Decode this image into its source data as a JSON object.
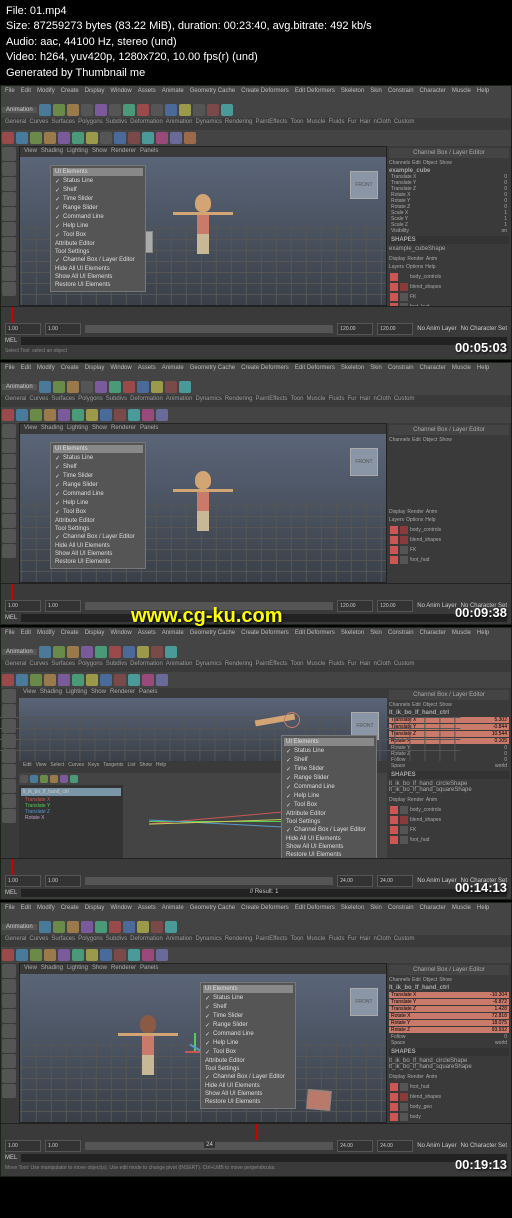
{
  "meta": {
    "file": "File: 01.mp4",
    "size": "Size: 87259273 bytes (83.22 MiB), duration: 00:23:40, avg.bitrate: 492 kb/s",
    "audio": "Audio: aac, 44100 Hz, stereo (und)",
    "video": "Video: h264, yuv420p, 1280x720, 10.00 fps(r) (und)",
    "gen": "Generated by Thumbnail me"
  },
  "watermark": "www.cg-ku.com",
  "menubar": [
    "File",
    "Edit",
    "Modify",
    "Create",
    "Display",
    "Window",
    "Assets",
    "Animate",
    "Geometry Cache",
    "Create Deformers",
    "Edit Deformers",
    "Skeleton",
    "Skin",
    "Constrain",
    "Character",
    "Muscle",
    "Help"
  ],
  "shelfTabs": [
    "General",
    "Curves",
    "Surfaces",
    "Polygons",
    "Subdivs",
    "Deformation",
    "Animation",
    "Dynamics",
    "Rendering",
    "PaintEffects",
    "Toon",
    "Muscle",
    "Fluids",
    "Fur",
    "Hair",
    "nCloth",
    "Custom"
  ],
  "vpMenu": [
    "View",
    "Shading",
    "Lighting",
    "Show",
    "Renderer",
    "Panels"
  ],
  "geMenu": [
    "Edit",
    "View",
    "Select",
    "Curves",
    "Keys",
    "Tangents",
    "List",
    "Show",
    "Help"
  ],
  "dropdown": "Animation",
  "popup": {
    "header": "UI Elements",
    "items": [
      {
        "label": "Status Line",
        "checked": true
      },
      {
        "label": "Shelf",
        "checked": true
      },
      {
        "label": "Time Slider",
        "checked": true
      },
      {
        "label": "Range Slider",
        "checked": true
      },
      {
        "label": "Command Line",
        "checked": true
      },
      {
        "label": "Help Line",
        "checked": true
      },
      {
        "label": "Tool Box",
        "checked": true
      },
      {
        "label": "Attribute Editor",
        "checked": false
      },
      {
        "label": "Tool Settings",
        "checked": false
      },
      {
        "label": "Channel Box / Layer Editor",
        "checked": true
      },
      {
        "label": "Hide All UI Elements",
        "checked": false
      },
      {
        "label": "Show All UI Elements",
        "checked": false
      },
      {
        "label": "Restore UI Elements",
        "checked": false
      }
    ]
  },
  "channelBox": {
    "title": "Channel Box / Layer Editor",
    "tabs": [
      "Channels",
      "Edit",
      "Object",
      "Show"
    ],
    "layerTabs": [
      "Display",
      "Render",
      "Anim"
    ],
    "layerMenu": [
      "Layers",
      "Options",
      "Help"
    ]
  },
  "shapesLabel": "SHAPES",
  "cubeLabel": "FRONT",
  "timeRange": {
    "start": "1.00",
    "end": "120.00",
    "cur": "1.00"
  },
  "timeRange3": {
    "start": "1.00",
    "end": "24.00"
  },
  "mel": "MEL",
  "noAnim": "No Anim Layer",
  "noChar": "No Character Set",
  "result": "// Result: 1",
  "s1": {
    "timecode": "00:05:03",
    "status": "Select Tool: select an object",
    "object": "example_cube",
    "attrs": [
      {
        "n": "Translate X",
        "v": "0"
      },
      {
        "n": "Translate Y",
        "v": "0"
      },
      {
        "n": "Translate Z",
        "v": "0"
      },
      {
        "n": "Rotate X",
        "v": "0"
      },
      {
        "n": "Rotate Y",
        "v": "0"
      },
      {
        "n": "Rotate Z",
        "v": "0"
      },
      {
        "n": "Scale X",
        "v": "1"
      },
      {
        "n": "Scale Y",
        "v": "1"
      },
      {
        "n": "Scale Z",
        "v": "1"
      },
      {
        "n": "Visibility",
        "v": "on"
      }
    ],
    "shape": "example_cubeShape",
    "layers": [
      {
        "n": "body_controls",
        "c": "#555"
      },
      {
        "n": "blend_shapes",
        "c": "#8a3a3a"
      },
      {
        "n": "FK",
        "c": "#555"
      },
      {
        "n": "foot_hud",
        "c": "#555"
      }
    ]
  },
  "s2": {
    "timecode": "00:09:38",
    "status": "",
    "layers": [
      {
        "n": "body_controls",
        "c": "#8a3a3a"
      },
      {
        "n": "blend_shapes",
        "c": "#8a3a3a"
      },
      {
        "n": "FK",
        "c": "#555"
      },
      {
        "n": "foot_hud",
        "c": "#555"
      }
    ]
  },
  "s3": {
    "timecode": "00:14:13",
    "object": "lt_ik_bo_lf_hand_ctrl",
    "attrs": [
      {
        "n": "Translate X",
        "v": "5.302"
      },
      {
        "n": "Translate Y",
        "v": "-0.844"
      },
      {
        "n": "Translate Z",
        "v": "10.544"
      },
      {
        "n": "Rotate X",
        "v": "0.105"
      },
      {
        "n": "Rotate Y",
        "v": "0"
      },
      {
        "n": "Rotate Z",
        "v": "0"
      },
      {
        "n": "Follow",
        "v": "0"
      },
      {
        "n": "Space",
        "v": "world"
      }
    ],
    "shapes": [
      "lt_ik_bo_lf_hand_circleShape",
      "lt_ik_bo_lf_hand_squareShape"
    ],
    "outliner": {
      "item": "lt_ik_bo_lf_hand_ctrl",
      "attrs": [
        "Translate X",
        "Translate Y",
        "Translate Z",
        "Rotate X"
      ]
    },
    "layers": [
      {
        "n": "body_controls",
        "c": "#555"
      },
      {
        "n": "blend_shapes",
        "c": "#8a3a3a"
      },
      {
        "n": "FK",
        "c": "#555"
      },
      {
        "n": "foot_hud",
        "c": "#555"
      }
    ]
  },
  "s4": {
    "timecode": "00:19:13",
    "status": "Move Tool: Use manipulator to move object(s). Use edit mode to change pivot (INSERT). Ctrl+LMB to move perpendicular.",
    "object": "lt_ik_bo_lf_hand_ctrl",
    "attrs": [
      {
        "n": "Translate X",
        "v": "-10.304"
      },
      {
        "n": "Translate Y",
        "v": "-6.872"
      },
      {
        "n": "Translate Z",
        "v": "1.428"
      },
      {
        "n": "Rotate X",
        "v": "72.818"
      },
      {
        "n": "Rotate Y",
        "v": "18.075"
      },
      {
        "n": "Rotate Z",
        "v": "93.932"
      },
      {
        "n": "Follow",
        "v": "0"
      },
      {
        "n": "Space",
        "v": "world"
      }
    ],
    "shapes": [
      "lt_ik_bo_lf_hand_circleShape",
      "lt_ik_bo_lf_hand_squareShape"
    ],
    "cur": "24",
    "layers": [
      {
        "n": "foot_hud",
        "c": "#555"
      },
      {
        "n": "blend_shapes",
        "c": "#8a3a3a"
      },
      {
        "n": "body_geo",
        "c": "#555"
      },
      {
        "n": "body",
        "c": "#555"
      }
    ]
  }
}
